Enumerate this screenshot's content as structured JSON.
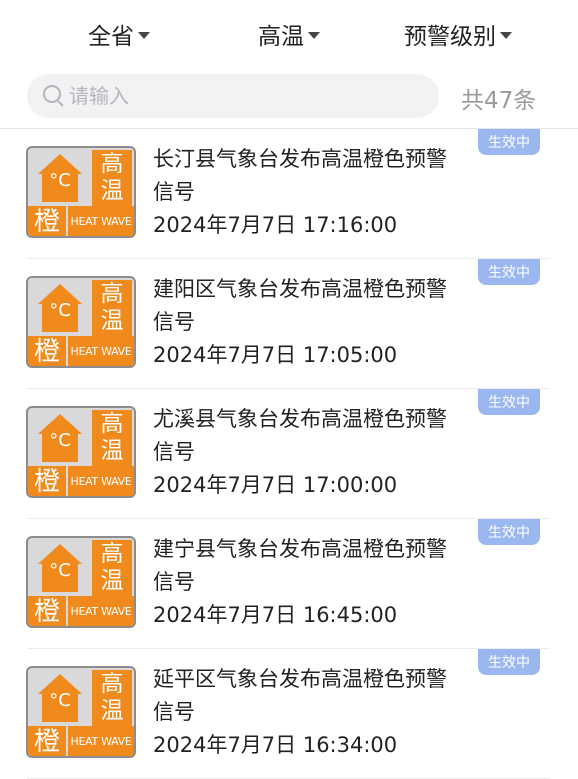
{
  "filters": {
    "province": "全省",
    "type": "高温",
    "level": "预警级别"
  },
  "search": {
    "placeholder": "请输入",
    "value": ""
  },
  "total_label": "共47条",
  "colors": {
    "badge": "#9ab8ef",
    "warning_orange": "#f08a1c",
    "warning_gray": "#d9d9d9"
  },
  "warning_icon": {
    "temp_symbol": "°C",
    "char1": "高",
    "char2": "温",
    "level_char": "橙",
    "caption": "HEAT WAVE"
  },
  "items": [
    {
      "title": "长汀县气象台发布高温橙色预警信号",
      "time": "2024年7月7日 17:16:00",
      "status": "生效中"
    },
    {
      "title": "建阳区气象台发布高温橙色预警信号",
      "time": "2024年7月7日 17:05:00",
      "status": "生效中"
    },
    {
      "title": "尤溪县气象台发布高温橙色预警信号",
      "time": "2024年7月7日 17:00:00",
      "status": "生效中"
    },
    {
      "title": "建宁县气象台发布高温橙色预警信号",
      "time": "2024年7月7日 16:45:00",
      "status": "生效中"
    },
    {
      "title": "延平区气象台发布高温橙色预警信号",
      "time": "2024年7月7日 16:34:00",
      "status": "生效中"
    }
  ]
}
